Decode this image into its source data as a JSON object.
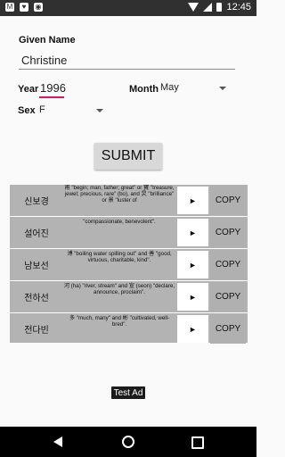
{
  "status": {
    "time": "12:45"
  },
  "form": {
    "given_name_label": "Given Name",
    "given_name_value": "Christine",
    "year_label": "Year",
    "year_value": "1996",
    "month_label": "Month",
    "month_value": "May",
    "sex_label": "Sex",
    "sex_value": "F",
    "submit_label": "SUBMIT"
  },
  "results": [
    {
      "name": "신보경",
      "meaning": "甫 \"begin; man, father; great\" or 寶 \"treasure, jewel; precious, rare\" (bo), and 炅 \"brilliance\" or 景 \"luster of",
      "play": "►",
      "copy": "COPY"
    },
    {
      "name": "설어진",
      "meaning": "\"compassionate, benevolent\".",
      "play": "►",
      "copy": "COPY"
    },
    {
      "name": "남보선",
      "meaning": "溥 \"boiling water spilling out\" and 善 \"good, virtuous, charitable, kind\".",
      "play": "►",
      "copy": "COPY"
    },
    {
      "name": "전하선",
      "meaning": "河 (ha) \"river, stream\" and 宣 (seon) \"declare, announce, proclaim\".",
      "play": "►",
      "copy": "COPY"
    },
    {
      "name": "전다빈",
      "meaning": "多 \"much, many\" and 彬 \"cultivated, well-bred\".",
      "play": "►",
      "copy": "COPY"
    }
  ],
  "ad": {
    "label": "Test Ad"
  }
}
